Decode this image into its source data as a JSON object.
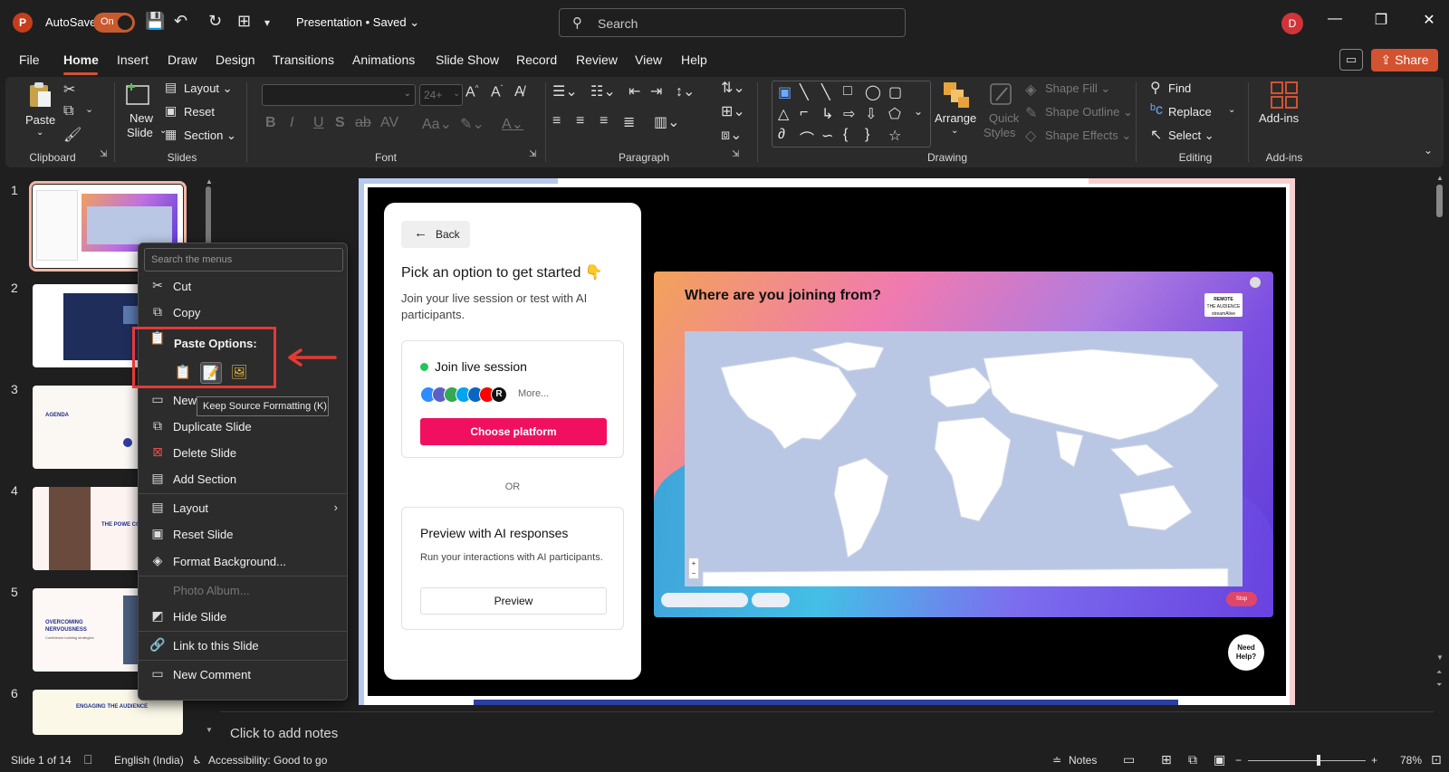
{
  "titlebar": {
    "app_logo": "P",
    "autosave_label": "AutoSave",
    "autosave_state": "On",
    "doc_title": "Presentation • Saved",
    "search_placeholder": "Search",
    "user_initial": "D"
  },
  "tabs": [
    "File",
    "Home",
    "Insert",
    "Draw",
    "Design",
    "Transitions",
    "Animations",
    "Slide Show",
    "Record",
    "Review",
    "View",
    "Help"
  ],
  "active_tab": "Home",
  "share_label": "Share",
  "ribbon": {
    "groups": {
      "clipboard": "Clipboard",
      "slides": "Slides",
      "font": "Font",
      "paragraph": "Paragraph",
      "drawing": "Drawing",
      "editing": "Editing",
      "addins": "Add-ins"
    },
    "paste": "Paste",
    "new_slide": [
      "New",
      "Slide"
    ],
    "layout": "Layout",
    "reset": "Reset",
    "section": "Section",
    "font_size": "24+",
    "arrange": "Arrange",
    "quick_styles": [
      "Quick",
      "Styles"
    ],
    "shape_fill": "Shape Fill",
    "shape_outline": "Shape Outline",
    "shape_effects": "Shape Effects",
    "find": "Find",
    "replace": "Replace",
    "select": "Select",
    "addins_btn": "Add-ins"
  },
  "thumbnails": [
    {
      "num": "1",
      "selected": true
    },
    {
      "num": "2",
      "selected": false
    },
    {
      "num": "3",
      "text": "AGENDA",
      "selected": false
    },
    {
      "num": "4",
      "text": "THE POWE COMMUNIC",
      "selected": false
    },
    {
      "num": "5",
      "text": "OVERCOMING NERVOUSNESS",
      "sub": "Confidence building strategies",
      "selected": false
    },
    {
      "num": "6",
      "text": "ENGAGING THE AUDIENCE",
      "selected": false
    }
  ],
  "slide": {
    "back_label": "Back",
    "pick_title": "Pick an option to get started 👇",
    "pick_sub": "Join your live session or test with AI participants.",
    "join_title": "Join live session",
    "more_label": "More...",
    "choose_btn": "Choose platform",
    "or_label": "OR",
    "preview_title": "Preview with AI responses",
    "preview_sub": "Run your interactions with AI participants.",
    "preview_btn": "Preview",
    "map_question": "Where are you joining from?",
    "brand_lines": [
      "REMOTE",
      "THE AUDIENCE",
      "streamAlive"
    ],
    "stop_label": "Stop",
    "help_label": [
      "Need",
      "Help?"
    ]
  },
  "notes_placeholder": "Click to add notes",
  "context_menu": {
    "search_placeholder": "Search the menus",
    "cut": "Cut",
    "copy": "Copy",
    "paste_options": "Paste Options:",
    "new_slide": "New",
    "duplicate_slide": "Duplicate Slide",
    "delete_slide": "Delete Slide",
    "add_section": "Add Section",
    "layout": "Layout",
    "reset_slide": "Reset Slide",
    "format_background": "Format Background...",
    "photo_album": "Photo Album...",
    "hide_slide": "Hide Slide",
    "link_to_slide": "Link to this Slide",
    "new_comment": "New Comment",
    "tooltip": "Keep Source Formatting (K)"
  },
  "statusbar": {
    "slide_count": "Slide 1 of 14",
    "language": "English (India)",
    "accessibility": "Accessibility: Good to go",
    "notes": "Notes",
    "zoom": "78%"
  },
  "colors": {
    "accent": "#d35230",
    "highlight_red": "#e53935",
    "choose_btn": "#f0105f"
  }
}
